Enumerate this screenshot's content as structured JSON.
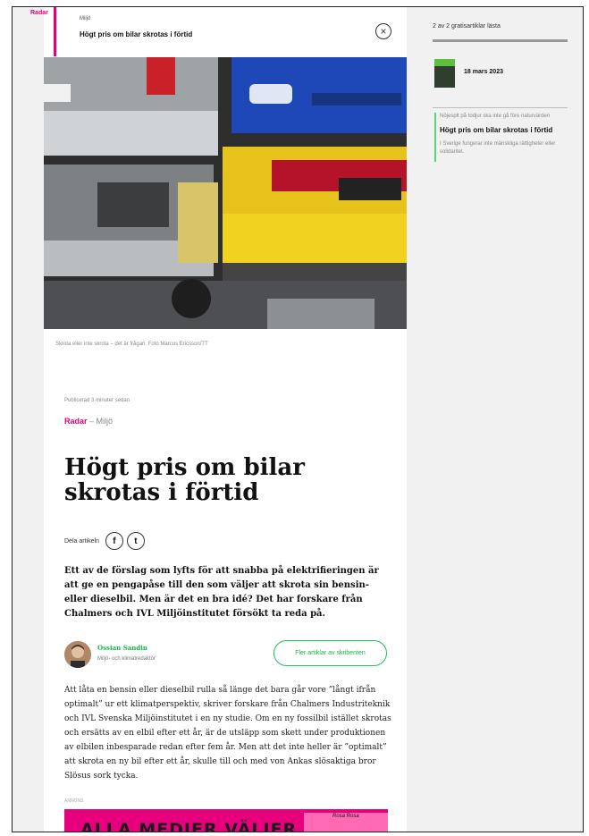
{
  "header": {
    "section_tag": "Radar",
    "category": "Miljö",
    "title": "Högt pris om bilar skrotas i förtid",
    "close_icon": "×"
  },
  "hero": {
    "caption": "Skrota eller inte skrota – det är frågan. Foto Marcus Ericsson/TT"
  },
  "article": {
    "published": "Publicerad 3 minuter sedan",
    "kicker_section": "Radar",
    "kicker_separator": " – ",
    "kicker_category": "Miljö",
    "title": "Högt pris om bilar skrotas i förtid",
    "share_label": "Dela artikeln",
    "share_icons": {
      "facebook": "f",
      "twitter": "t"
    },
    "lead": "Ett av de förslag som lyfts för att snabba på elektrifieringen är att ge en pengapåse till den som väljer att skrota sin bensin- eller dieselbil. Men är det en bra idé? Det har forskare från Chalmers och IVL Miljöinstitutet försökt ta reda på.",
    "author_name": "Ossian Sandin",
    "author_role": "Miljö- och klimatredaktör",
    "more_button": "Fler artiklar av skribenten",
    "body": "Att låta en bensin eller dieselbil rulla så länge det bara går vore ”långt ifrån optimalt” ur ett klimatperspektiv, skriver forskare från Chalmers Industriteknik och IVL Svenska Miljöinstitutet i en ny studie. Om en ny fossilbil istället skrotas och ersätts av en elbil efter ett år, är de utsläpp som skett under produktionen av elbilen inbesparade redan efter fem år. Men att det inte heller är ”optimalt” att skrota en ny bil efter ett år, skulle till och med von Ankas slösaktiga bror Slösus sork tycka.",
    "ad_label": "ANNONS",
    "ad_text": "ALLA MEDIER VÄLJER",
    "ad_script": "Rosa Rosa"
  },
  "sidebar": {
    "counter": "2 av 2 gratisartiklar lästa",
    "date": "18 mars 2023",
    "items": [
      "Nöjesplt på todjur ska inte gå före naturvärden",
      "Högt pris om bilar skrotas i förtid",
      "I Sverige fungerar inte mänskliga rättigheter eller solidaritet."
    ]
  },
  "colors": {
    "accent": "#e4007c",
    "author_green": "#16b44a"
  }
}
